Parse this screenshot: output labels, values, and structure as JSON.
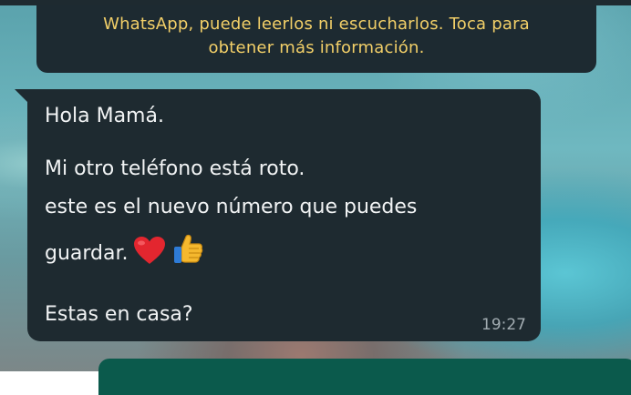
{
  "encryption_notice": {
    "line1": "WhatsApp, puede leerlos ni escucharlos. Toca para",
    "line2": "obtener más información."
  },
  "message": {
    "lines": [
      "Hola Mamá.",
      "Mi otro teléfono está roto.",
      "este es el nuevo número que puedes",
      "guardar.",
      "Estas en casa?"
    ],
    "emojis": [
      "red-heart",
      "thumbs-up"
    ],
    "time": "19:27"
  },
  "colors": {
    "bubble": "#1e2a30",
    "notice_text": "#f2cf68",
    "outgoing_bubble": "#0b5a4c"
  }
}
